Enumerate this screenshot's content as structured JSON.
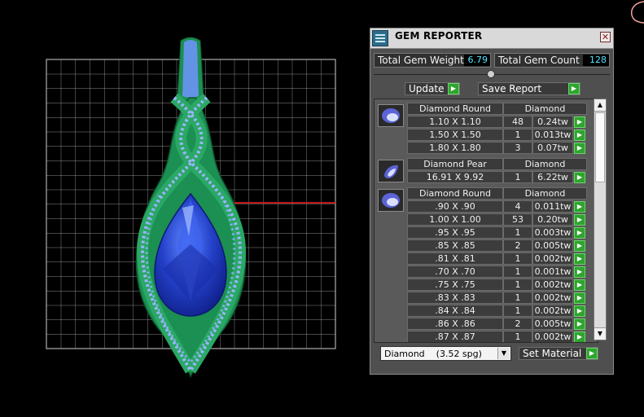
{
  "window": {
    "title": "GEM REPORTER",
    "close_glyph": "✕"
  },
  "stats": {
    "weight_label": "Total Gem Weight",
    "weight_value": "6.79",
    "count_label": "Total Gem Count",
    "count_value": "128"
  },
  "actions": {
    "update_label": "Update",
    "save_label": "Save Report"
  },
  "groups": [
    {
      "shape": "Diamond Round",
      "material": "Diamond",
      "icon": "round-gem-icon",
      "rows": [
        {
          "size": "1.10 X 1.10",
          "count": "48",
          "weight": "0.24tw"
        },
        {
          "size": "1.50 X 1.50",
          "count": "1",
          "weight": "0.013tw"
        },
        {
          "size": "1.80 X 1.80",
          "count": "3",
          "weight": "0.07tw"
        }
      ]
    },
    {
      "shape": "Diamond Pear",
      "material": "Diamond",
      "icon": "pear-gem-icon",
      "rows": [
        {
          "size": "16.91 X 9.92",
          "count": "1",
          "weight": "6.22tw"
        }
      ]
    },
    {
      "shape": "Diamond Round",
      "material": "Diamond",
      "icon": "round-gem-icon",
      "rows": [
        {
          "size": ".90 X .90",
          "count": "4",
          "weight": "0.011tw"
        },
        {
          "size": "1.00 X 1.00",
          "count": "53",
          "weight": "0.20tw"
        },
        {
          "size": ".95 X .95",
          "count": "1",
          "weight": "0.003tw"
        },
        {
          "size": ".85 X .85",
          "count": "2",
          "weight": "0.005tw"
        },
        {
          "size": ".81 X .81",
          "count": "1",
          "weight": "0.002tw"
        },
        {
          "size": ".70 X .70",
          "count": "1",
          "weight": "0.001tw"
        },
        {
          "size": ".75 X .75",
          "count": "1",
          "weight": "0.002tw"
        },
        {
          "size": ".83 X .83",
          "count": "1",
          "weight": "0.002tw"
        },
        {
          "size": ".84 X .84",
          "count": "1",
          "weight": "0.002tw"
        },
        {
          "size": ".86 X .86",
          "count": "2",
          "weight": "0.005tw"
        },
        {
          "size": ".87 X .87",
          "count": "1",
          "weight": "0.002tw"
        }
      ]
    }
  ],
  "material": {
    "selected": "Diamond    (3.52 spg)",
    "set_label": "Set Material"
  },
  "colors": {
    "accent_value": "#55e5ff",
    "go_green": "#2fa52f",
    "gem_blue": "#2340c8",
    "setting_green": "#1c8f52"
  }
}
